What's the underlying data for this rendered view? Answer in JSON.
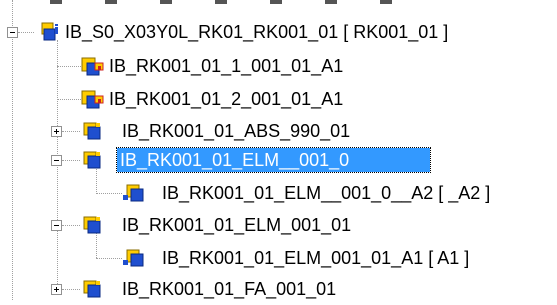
{
  "tree": {
    "nodes": [
      {
        "label": "IB_S0_X03Y0L_RK01_RK001_01 [ RK001_01 ]",
        "expander": "minus",
        "icon": "group-cube-icon",
        "selected": false
      },
      {
        "label": "IB_RK001_01_1_001_01_A1",
        "expander": "none",
        "icon": "cube-with-hook-icon",
        "selected": false
      },
      {
        "label": "IB_RK001_01_2_001_01_A1",
        "expander": "none",
        "icon": "cube-with-hook-icon",
        "selected": false
      },
      {
        "label": "IB_RK001_01_ABS_990_01",
        "expander": "plus",
        "icon": "cube-icon",
        "selected": false
      },
      {
        "label": "IB_RK001_01_ELM__001_0",
        "expander": "minus",
        "icon": "cube-icon",
        "selected": true
      },
      {
        "label": "IB_RK001_01_ELM__001_0__A2 [ _A2 ]",
        "expander": "none",
        "icon": "cube-with-pin-icon",
        "selected": false
      },
      {
        "label": "IB_RK001_01_ELM_001_01",
        "expander": "minus",
        "icon": "cube-icon",
        "selected": false
      },
      {
        "label": "IB_RK001_01_ELM_001_01_A1 [ A1 ]",
        "expander": "none",
        "icon": "cube-with-pin-icon",
        "selected": false
      },
      {
        "label": "IB_RK001_01_FA_001_01",
        "expander": "plus",
        "icon": "cube-icon",
        "selected": false
      }
    ]
  },
  "colors": {
    "selection": "#3399ff",
    "cube_yellow": "#ffcc00",
    "cube_blue": "#1f4fcf",
    "hook_red": "#cc2222"
  }
}
